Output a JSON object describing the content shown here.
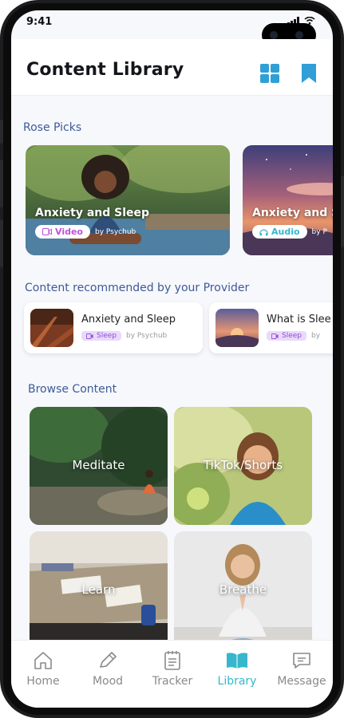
{
  "status_bar": {
    "time": "9:41"
  },
  "header": {
    "title": "Content Library",
    "grid_icon": "grid-icon",
    "bookmark_icon": "bookmark-icon",
    "accent_color": "#2f9fd6"
  },
  "rose_picks": {
    "title": "Rose Picks",
    "cards": [
      {
        "title": "Anxiety and Sleep",
        "type": "Video",
        "type_icon": "video-icon",
        "by": "by Psychub"
      },
      {
        "title": "Anxiety and Sleep",
        "type": "Audio",
        "type_icon": "headphones-icon",
        "by": "by P"
      }
    ]
  },
  "provider_recs": {
    "title": "Content recommended by your Provider",
    "items": [
      {
        "title": "Anxiety and Sleep",
        "tag": "Sleep",
        "by": "by Psychub"
      },
      {
        "title": "What is Slee",
        "tag": "Sleep",
        "by": "by"
      }
    ]
  },
  "browse": {
    "title": "Browse Content",
    "tiles": [
      {
        "label": "Meditate"
      },
      {
        "label": "TikTok/Shorts"
      },
      {
        "label": "Learn"
      },
      {
        "label": "Breathe"
      }
    ]
  },
  "tab_bar": {
    "active": "Library",
    "active_color": "#36b7cc",
    "tabs": [
      {
        "label": "Home",
        "icon": "home-icon"
      },
      {
        "label": "Mood",
        "icon": "pencil-icon"
      },
      {
        "label": "Tracker",
        "icon": "notepad-icon"
      },
      {
        "label": "Library",
        "icon": "book-icon"
      },
      {
        "label": "Message",
        "icon": "chat-icon"
      }
    ]
  }
}
